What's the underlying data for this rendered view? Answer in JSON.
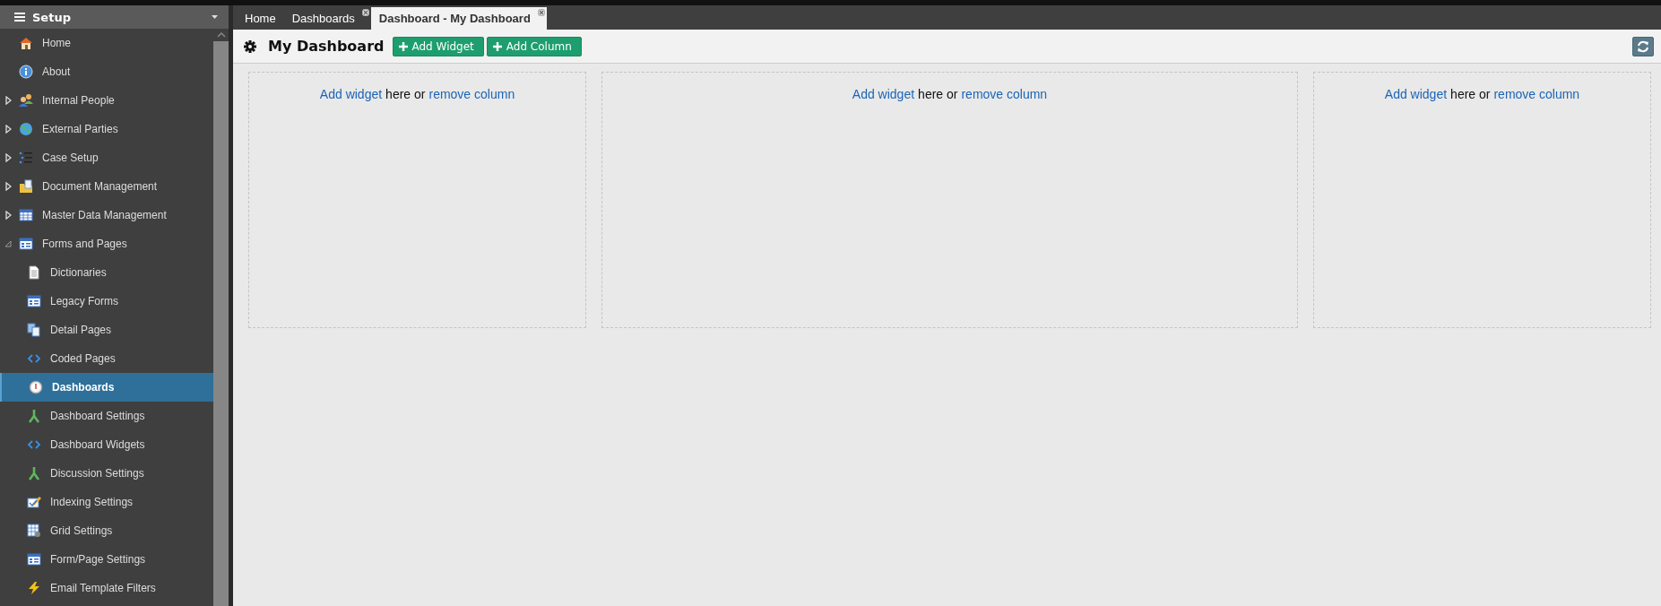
{
  "sidebar": {
    "title": "Setup",
    "items": [
      {
        "label": "Home",
        "kind": "home",
        "selected": false
      },
      {
        "label": "About",
        "kind": "info",
        "selected": false
      },
      {
        "label": "Internal People",
        "kind": "people",
        "selected": false,
        "expanded": false
      },
      {
        "label": "External Parties",
        "kind": "globe",
        "selected": false,
        "expanded": false
      },
      {
        "label": "Case Setup",
        "kind": "list",
        "selected": false,
        "expanded": false
      },
      {
        "label": "Document Management",
        "kind": "folder",
        "selected": false,
        "expanded": false
      },
      {
        "label": "Master Data Management",
        "kind": "table",
        "selected": false,
        "expanded": false
      },
      {
        "label": "Forms and Pages",
        "kind": "form",
        "selected": false,
        "expanded": true,
        "children": [
          {
            "label": "Dictionaries",
            "kind": "document",
            "selected": false
          },
          {
            "label": "Legacy Forms",
            "kind": "form",
            "selected": false
          },
          {
            "label": "Detail Pages",
            "kind": "pages",
            "selected": false
          },
          {
            "label": "Coded Pages",
            "kind": "code",
            "selected": false
          },
          {
            "label": "Dashboards",
            "kind": "dial",
            "selected": true
          },
          {
            "label": "Dashboard Settings",
            "kind": "fork",
            "selected": false
          },
          {
            "label": "Dashboard Widgets",
            "kind": "code",
            "selected": false
          },
          {
            "label": "Discussion Settings",
            "kind": "fork",
            "selected": false
          },
          {
            "label": "Indexing Settings",
            "kind": "edit",
            "selected": false
          },
          {
            "label": "Grid Settings",
            "kind": "grid",
            "selected": false
          },
          {
            "label": "Form/Page Settings",
            "kind": "form",
            "selected": false
          },
          {
            "label": "Email Template Filters",
            "kind": "lightning",
            "selected": false
          }
        ]
      }
    ]
  },
  "tabs": [
    {
      "label": "Home",
      "selected": false,
      "closable": false
    },
    {
      "label": "Dashboards",
      "selected": false,
      "closable": true
    },
    {
      "label": "Dashboard - My Dashboard",
      "selected": true,
      "closable": true
    }
  ],
  "toolbar": {
    "title": "My Dashboard",
    "buttons": [
      "Add Widget",
      "Add Column"
    ]
  },
  "columns": [
    {
      "add_link": "Add widget",
      "middle": "here or",
      "remove_link": "remove column"
    },
    {
      "add_link": "Add widget",
      "middle": "here or",
      "remove_link": "remove column"
    },
    {
      "add_link": "Add widget",
      "middle": "here or",
      "remove_link": "remove column"
    }
  ]
}
